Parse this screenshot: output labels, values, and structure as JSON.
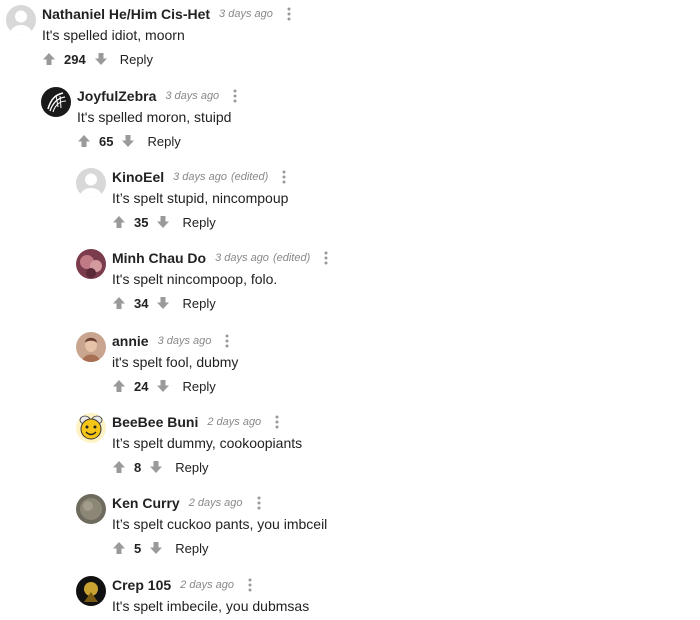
{
  "comments": [
    {
      "author": "Nathaniel He/Him Cis-Het",
      "time": "3 days ago",
      "edited": "",
      "text": "It's spelled idiot, moorn",
      "votes": "294",
      "reply": "Reply",
      "avatar_icon": "default-avatar"
    },
    {
      "author": "JoyfulZebra",
      "time": "3 days ago",
      "edited": "",
      "text": "It's spelled moron, stuipd",
      "votes": "65",
      "reply": "Reply",
      "avatar_icon": "zebra-avatar"
    },
    {
      "author": "KinoEel",
      "time": "3 days ago",
      "edited": "(edited)",
      "text": "It’s spelt stupid, nincompoup",
      "votes": "35",
      "reply": "Reply",
      "avatar_icon": "default-avatar"
    },
    {
      "author": "Minh Chau Do",
      "time": "3 days ago",
      "edited": "(edited)",
      "text": "It's spelt nincompoop, folo.",
      "votes": "34",
      "reply": "Reply",
      "avatar_icon": "photo-avatar"
    },
    {
      "author": "annie",
      "time": "3 days ago",
      "edited": "",
      "text": "it's spelt fool, dubmy",
      "votes": "24",
      "reply": "Reply",
      "avatar_icon": "photo-avatar"
    },
    {
      "author": "BeeBee Buni",
      "time": "2 days ago",
      "edited": "",
      "text": "It’s spelt dummy, cookoopiants",
      "votes": "8",
      "reply": "Reply",
      "avatar_icon": "bee-avatar"
    },
    {
      "author": "Ken Curry",
      "time": "2 days ago",
      "edited": "",
      "text": "It’s spelt cuckoo pants, you imbceil",
      "votes": "5",
      "reply": "Reply",
      "avatar_icon": "photo-avatar"
    },
    {
      "author": "Crep 105",
      "time": "2 days ago",
      "edited": "",
      "text": "It's spelt imbecile, you dubmsas",
      "votes": "",
      "reply": "",
      "avatar_icon": "photo-avatar"
    }
  ],
  "colors": {
    "text": "#222222",
    "meta": "#888888",
    "icon": "#9a9a9a",
    "default_avatar_bg": "#d8d8d8"
  }
}
